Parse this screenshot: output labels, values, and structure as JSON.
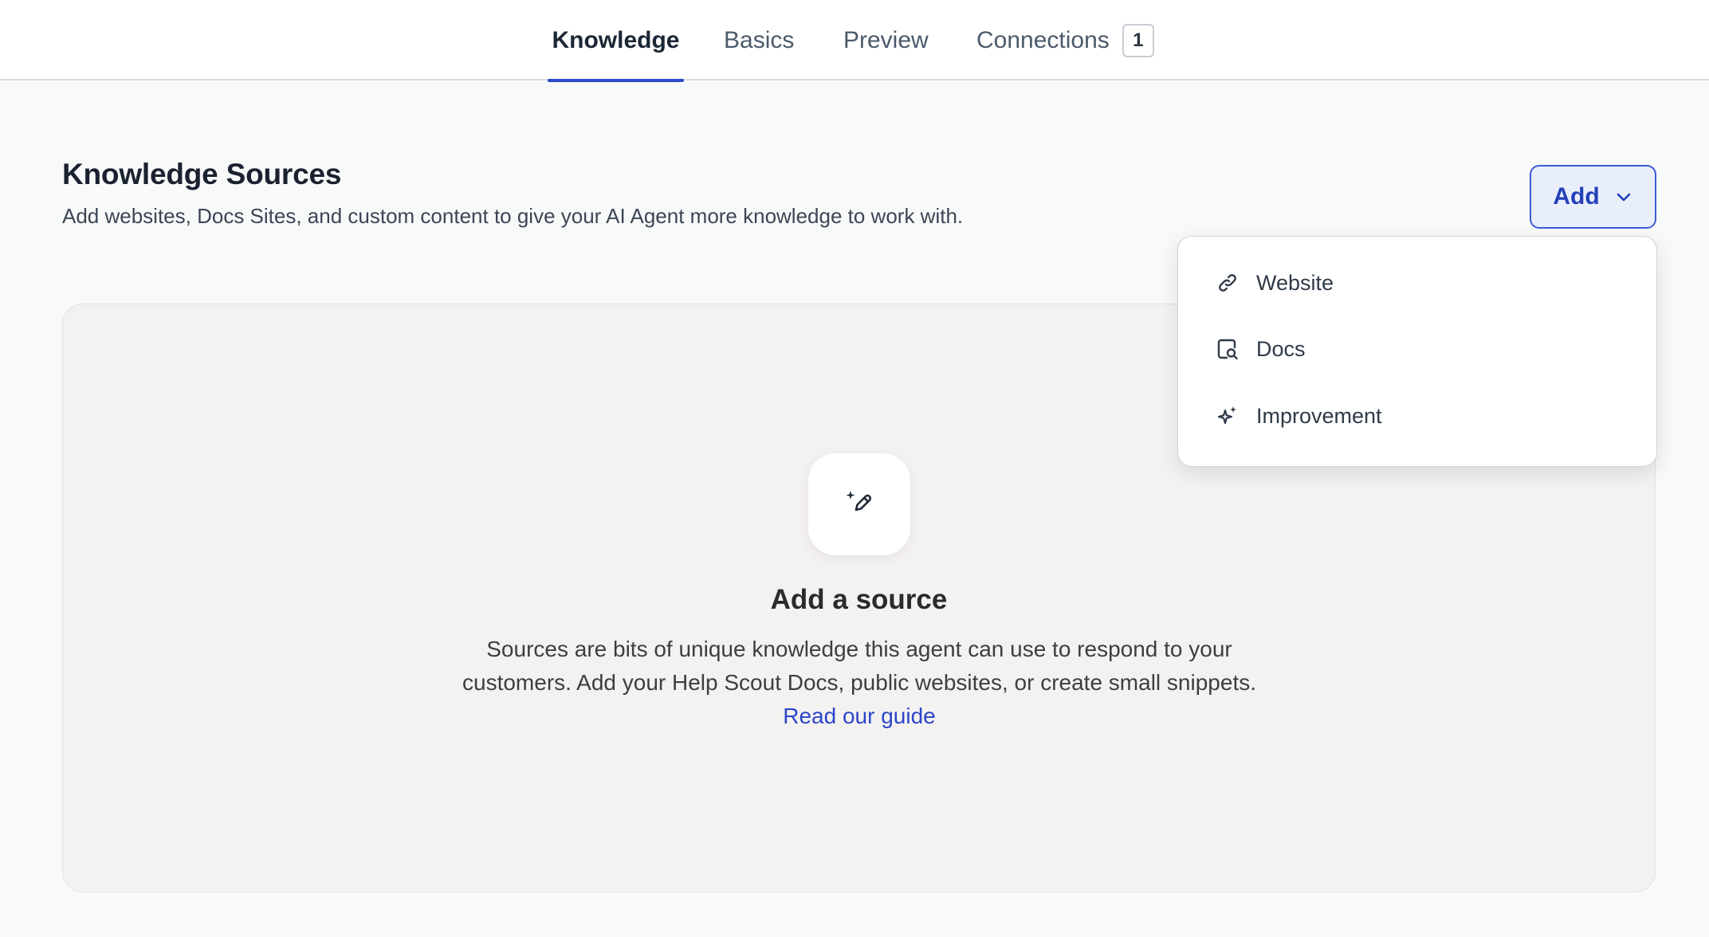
{
  "tabs": {
    "knowledge": "Knowledge",
    "basics": "Basics",
    "preview": "Preview",
    "connections": "Connections",
    "connections_count": "1"
  },
  "section": {
    "title": "Knowledge Sources",
    "description": "Add websites, Docs Sites, and custom content to give your AI Agent more knowledge to work with."
  },
  "add_button": {
    "label": "Add"
  },
  "dropdown": {
    "items": [
      {
        "label": "Website",
        "icon": "link-icon"
      },
      {
        "label": "Docs",
        "icon": "docs-search-icon"
      },
      {
        "label": "Improvement",
        "icon": "sparkle-icon"
      }
    ]
  },
  "empty_state": {
    "icon": "magic-pencil-icon",
    "title": "Add a source",
    "description": "Sources are bits of unique knowledge this agent can use to respond to your customers. Add your Help Scout Docs, public websites, or create small snippets.",
    "link_text": "Read our guide"
  },
  "colors": {
    "accent": "#2f49c9",
    "button_bg": "#e9eefb",
    "card_bg": "#f4f2f1",
    "page_bg": "#f8f9f9"
  }
}
